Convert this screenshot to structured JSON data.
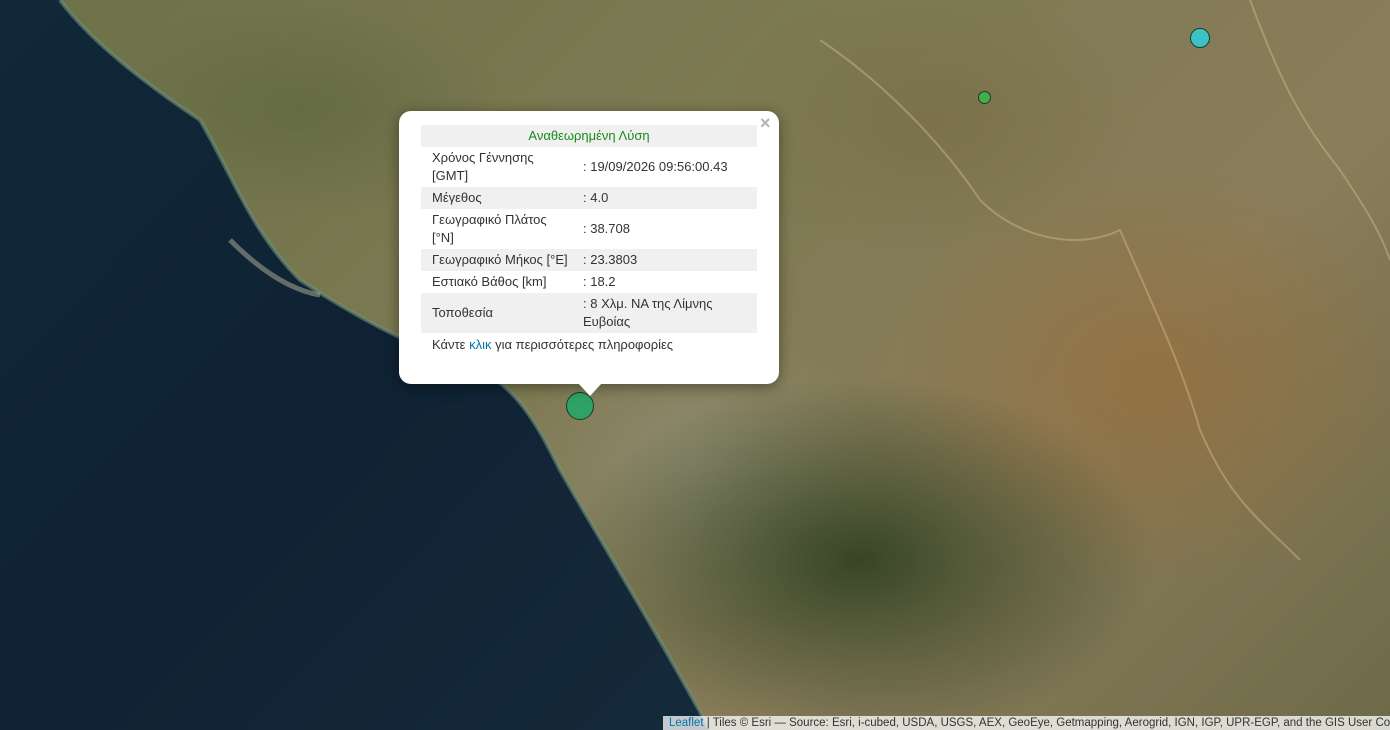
{
  "popup": {
    "title": "Αναθεωρημένη Λύση",
    "close": "×",
    "rows": [
      {
        "label": "Χρόνος Γέννησης [GMT]",
        "value": ": 19/09/2026 09:56:00.43"
      },
      {
        "label": "Μέγεθος",
        "value": ": 4.0"
      },
      {
        "label": "Γεωγραφικό Πλάτος [°N]",
        "value": ": 38.708"
      },
      {
        "label": "Γεωγραφικό Μήκος [°E]",
        "value": ": 23.3803"
      },
      {
        "label": "Εστιακό Βάθος [km]",
        "value": ": 18.2"
      },
      {
        "label": "Τοποθεσία",
        "value": ": 8 Χλμ. ΝΑ της Λίμνης Ευβοίας"
      }
    ],
    "footer_pre": "Κάντε ",
    "footer_link": "κλικ",
    "footer_post": " για περισσότερες πληροφορίες"
  },
  "markers": [
    {
      "name": "selected-earthquake",
      "color": "#2fa366"
    },
    {
      "name": "earthquake-cyan",
      "color": "#3cc3c8"
    },
    {
      "name": "earthquake-small-green",
      "color": "#43b047"
    }
  ],
  "attribution": {
    "link": "Leaflet",
    "text": " | Tiles © Esri — Source: Esri, i-cubed, USDA, USGS, AEX, GeoEye, Getmapping, Aerogrid, IGN, IGP, UPR-EGP, and the GIS User Community"
  }
}
